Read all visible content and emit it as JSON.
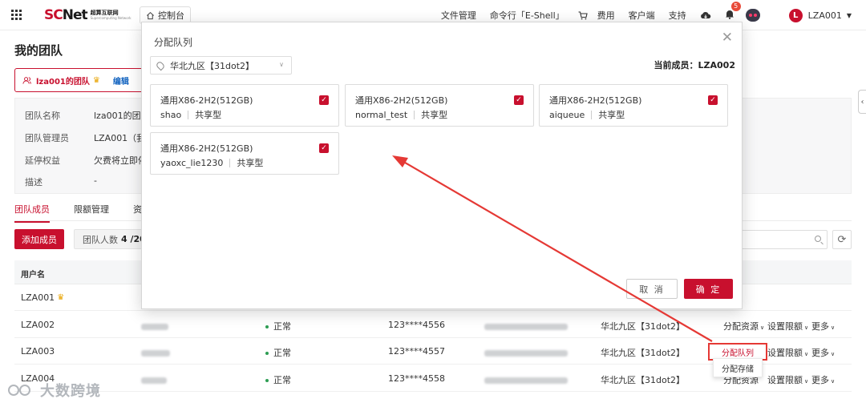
{
  "topbar": {
    "logo_main": "SC",
    "logo_main2": "Net",
    "logo_sub_cn": "超算互联网",
    "logo_sub_en": "Supercomputing Network",
    "console_label": "控制台",
    "nav": [
      "文件管理",
      "命令行「E-Shell」",
      "费用",
      "客户端",
      "支持"
    ],
    "notification_count": "5",
    "user_initial": "L",
    "user_name": "LZA001"
  },
  "page": {
    "title": "我的团队",
    "team_card": {
      "name": "lza001的团队",
      "edit_label": "编辑"
    },
    "info": [
      {
        "label": "团队名称",
        "value": "lza001的团队"
      },
      {
        "label": "团队管理员",
        "value": "LZA001（我"
      },
      {
        "label": "延停权益",
        "value": "欠费将立即停"
      },
      {
        "label": "描述",
        "value": "-"
      }
    ],
    "tabs": [
      "团队成员",
      "限额管理",
      "资"
    ],
    "add_member_label": "添加成员",
    "team_count_label": "团队人数",
    "team_count_value": "4 /20",
    "table": {
      "col_user": "用户名",
      "rows": [
        {
          "user": "LZA001",
          "status": "",
          "phone": "",
          "region": ""
        },
        {
          "user": "LZA002",
          "status": "正常",
          "phone": "123****4556",
          "region": "华北九区【31dot2】",
          "action1": "分配资源",
          "action2": "设置限额",
          "action3": "更多"
        },
        {
          "user": "LZA003",
          "status": "正常",
          "phone": "123****4557",
          "region": "华北九区【31dot2】",
          "action1": "分配队列",
          "action2": "设置限额",
          "action3": "更多"
        },
        {
          "user": "LZA004",
          "status": "正常",
          "phone": "123****4558",
          "region": "华北九区【31dot2】",
          "action1": "分配资源",
          "action2": "设置限额",
          "action3": "更多"
        }
      ]
    },
    "dropdown_item": "分配存储",
    "highlight_item": "分配队列"
  },
  "modal": {
    "title": "分配队列",
    "region": "华北九区【31dot2】",
    "current_member": "当前成员：LZA002",
    "queues": [
      {
        "title": "通用X86-2H2(512GB)",
        "name": "shao",
        "type": "共享型",
        "checked": true
      },
      {
        "title": "通用X86-2H2(512GB)",
        "name": "normal_test",
        "type": "共享型",
        "checked": true
      },
      {
        "title": "通用X86-2H2(512GB)",
        "name": "aiqueue",
        "type": "共享型",
        "checked": true
      },
      {
        "title": "通用X86-2H2(512GB)",
        "name": "yaoxc_lie1230",
        "type": "共享型",
        "checked": true
      }
    ],
    "cancel_label": "取 消",
    "ok_label": "确 定"
  },
  "watermark": "大数跨境",
  "colors": {
    "brand": "#c8102e",
    "link": "#1565c0",
    "annotation": "#e53935"
  }
}
